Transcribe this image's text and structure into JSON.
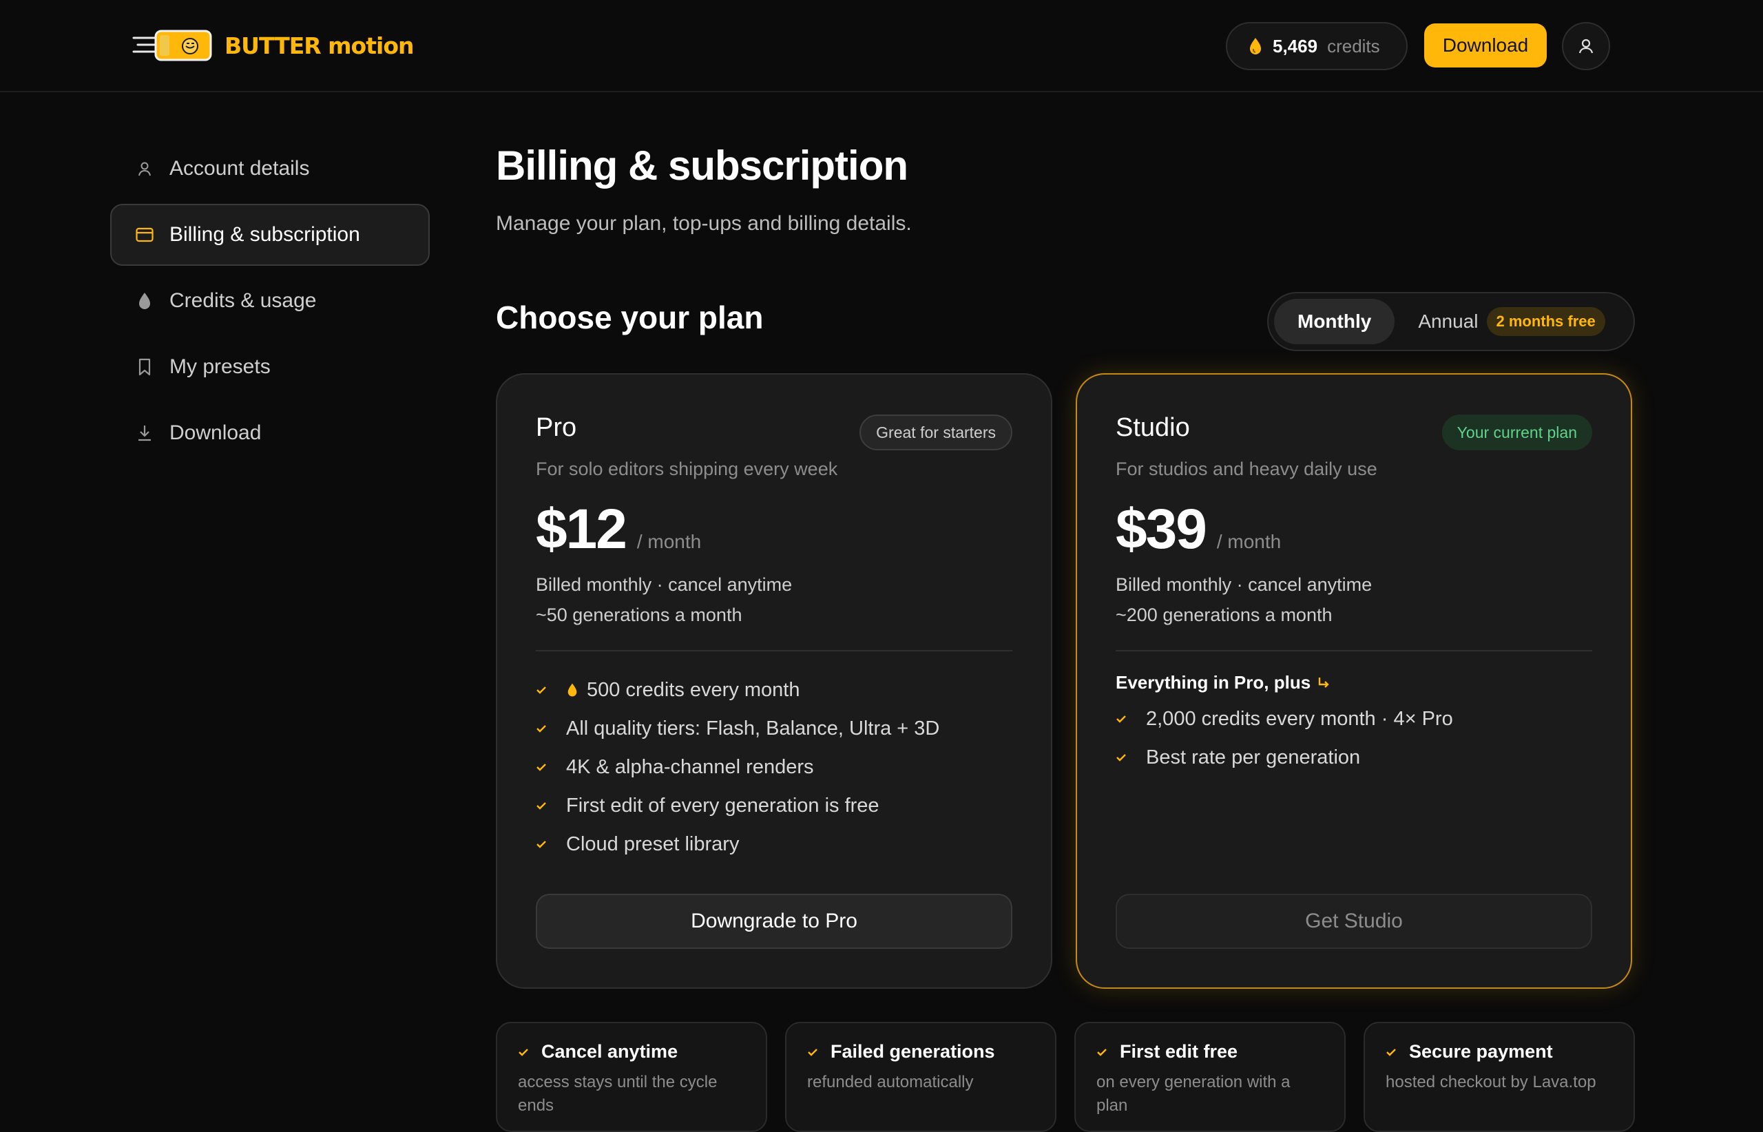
{
  "brand": {
    "name": "BUTTER motion",
    "accent": "#ffb80a",
    "success": "#5fd38a"
  },
  "header": {
    "credits_value": "5,469",
    "credits_label": "credits",
    "download_label": "Download",
    "credits_icon": "drop-icon",
    "avatar_icon": "user-icon"
  },
  "sidebar": {
    "items": [
      {
        "label": "Account details",
        "icon": "user-icon"
      },
      {
        "label": "Billing & subscription",
        "icon": "card-icon",
        "active": true
      },
      {
        "label": "Credits & usage",
        "icon": "drop-icon"
      },
      {
        "label": "My presets",
        "icon": "bookmark-icon"
      },
      {
        "label": "Download",
        "icon": "download-icon"
      }
    ]
  },
  "page": {
    "title": "Billing & subscription",
    "subtitle": "Manage your plan, top-ups and billing details.",
    "section_title": "Choose your plan"
  },
  "billing_toggle": {
    "monthly_label": "Monthly",
    "annual_label": "Annual",
    "annual_badge": "2 months free",
    "selected": "Monthly"
  },
  "plans": {
    "pro": {
      "name": "Pro",
      "tag": "Great for starters",
      "description": "For solo editors shipping every week",
      "price": "$12",
      "period": "/ month",
      "billing_note": "Billed monthly · cancel anytime",
      "generations": "~50 generations a month",
      "features": [
        "500 credits every month",
        "All quality tiers: Flash, Balance, Ultra + 3D",
        "4K & alpha-channel renders",
        "First edit of every generation is free",
        "Cloud preset library"
      ],
      "button_label": "Downgrade to Pro"
    },
    "studio": {
      "name": "Studio",
      "tag": "Your current plan",
      "description": "For studios and heavy daily use",
      "price": "$39",
      "period": "/ month",
      "billing_note": "Billed monthly · cancel anytime",
      "generations": "~200 generations a month",
      "plus_heading": "Everything in Pro, plus",
      "features": [
        "2,000 credits every month · 4× Pro",
        "Best rate per generation"
      ],
      "button_label": "Get Studio"
    }
  },
  "perks": [
    {
      "title": "Cancel anytime",
      "desc": "access stays until the cycle ends"
    },
    {
      "title": "Failed generations",
      "desc": "refunded automatically"
    },
    {
      "title": "First edit free",
      "desc": "on every generation with a plan"
    },
    {
      "title": "Secure payment",
      "desc": "hosted checkout by Lava.top"
    }
  ]
}
